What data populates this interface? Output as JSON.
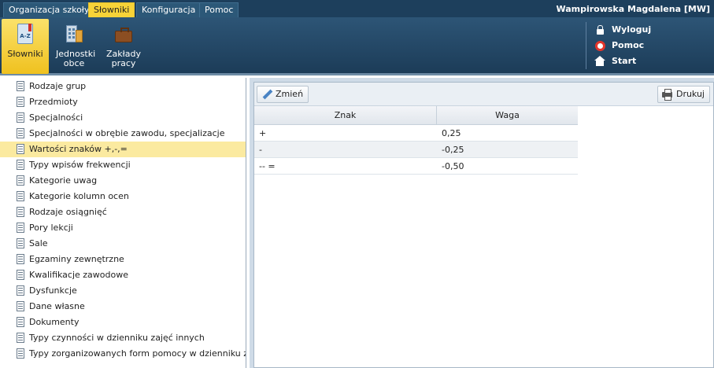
{
  "topbar": {
    "tabs": [
      {
        "label": "Organizacja szkoły",
        "active": false
      },
      {
        "label": "Słowniki",
        "active": true
      },
      {
        "label": "Konfiguracja",
        "active": false
      },
      {
        "label": "Pomoc",
        "active": false
      }
    ],
    "user": "Wampirowska Magdalena [MW]"
  },
  "ribbon": {
    "buttons": [
      {
        "label": "Słowniki",
        "icon": "dictionary-book-icon",
        "active": true
      },
      {
        "label": "Jednostki obce",
        "icon": "building-icon",
        "active": false
      },
      {
        "label": "Zakłady pracy",
        "icon": "briefcase-book-icon",
        "active": false
      }
    ],
    "links": [
      {
        "label": "Wyloguj",
        "icon": "lock-icon"
      },
      {
        "label": "Pomoc",
        "icon": "lifebuoy-icon"
      },
      {
        "label": "Start",
        "icon": "home-icon"
      }
    ]
  },
  "dictionaries": {
    "items": [
      "Rodzaje grup",
      "Przedmioty",
      "Specjalności",
      "Specjalności w obrębie zawodu, specjalizacje",
      "Wartości znaków +,-,=",
      "Typy wpisów frekwencji",
      "Kategorie uwag",
      "Kategorie kolumn ocen",
      "Rodzaje osiągnięć",
      "Pory lekcji",
      "Sale",
      "Egzaminy zewnętrzne",
      "Kwalifikacje zawodowe",
      "Dysfunkcje",
      "Dane własne",
      "Dokumenty",
      "Typy czynności w dzienniku zajęć innych",
      "Typy zorganizowanych form pomocy w dzienniku zajęć innych"
    ],
    "selected_index": 4
  },
  "toolbar": {
    "edit_label": "Zmień",
    "print_label": "Drukuj"
  },
  "grid": {
    "columns": [
      "Znak",
      "Waga"
    ],
    "rows": [
      [
        "+",
        "0,25"
      ],
      [
        "-",
        "-0,25"
      ],
      [
        "-- =",
        "-0,50"
      ]
    ]
  },
  "colors": {
    "header_bg": "#1d3f5c",
    "active_tab": "#f7d338",
    "selected_row": "#fbeaa0"
  }
}
